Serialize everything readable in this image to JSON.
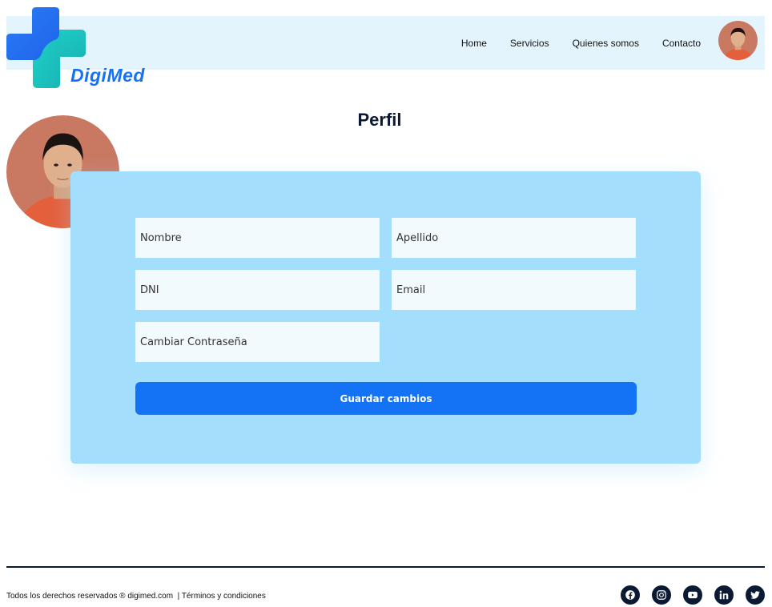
{
  "brand": {
    "name": "DigiMed"
  },
  "nav": {
    "items": [
      {
        "label": "Home"
      },
      {
        "label": "Servicios"
      },
      {
        "label": "Quienes somos"
      },
      {
        "label": "Contacto"
      }
    ]
  },
  "page": {
    "title": "Perfil"
  },
  "form": {
    "nombre_placeholder": "Nombre",
    "apellido_placeholder": "Apellido",
    "dni_placeholder": "DNI",
    "email_placeholder": "Email",
    "password_placeholder": "Cambiar Contraseña",
    "save_label": "Guardar cambios"
  },
  "footer": {
    "copyright": "Todos los derechos reservados ® digimed.com",
    "separator": "|",
    "terms_label": "Términos y condiciones"
  },
  "social": [
    "facebook-icon",
    "instagram-icon",
    "youtube-icon",
    "linkedin-icon",
    "twitter-icon"
  ],
  "colors": {
    "accent": "#1472f5",
    "card": "#a3defc",
    "navbar": "#e3f4fd",
    "edit_button": "#0f7f95",
    "dark": "#0b1a33"
  }
}
